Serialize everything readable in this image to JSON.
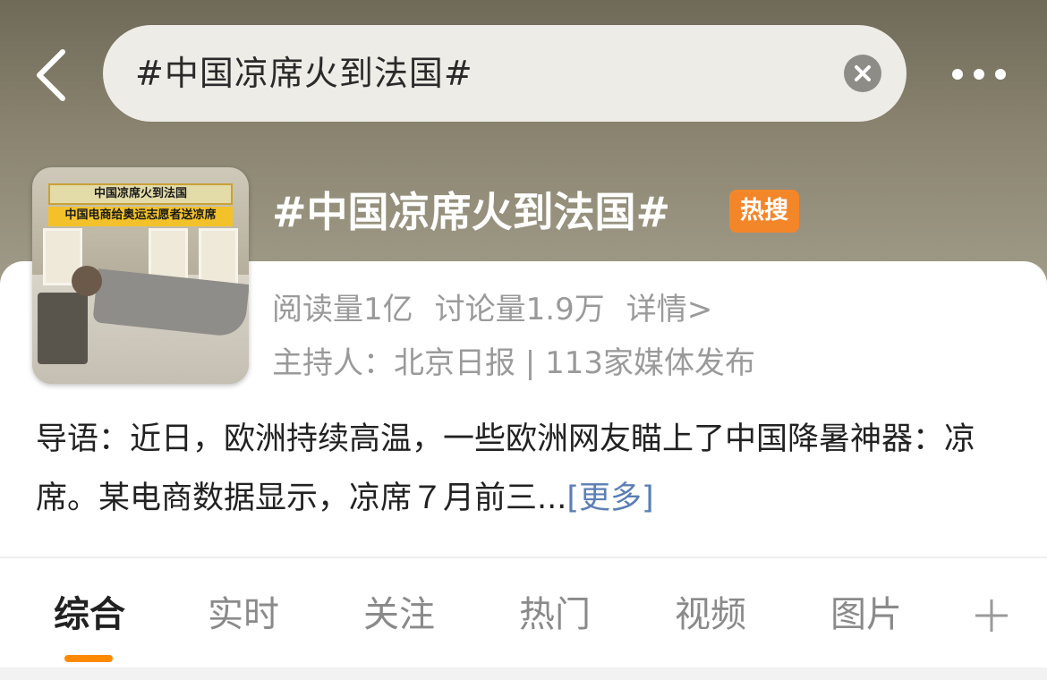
{
  "header": {
    "search_value": "#中国凉席火到法国#",
    "back_icon": "chevron-left-icon",
    "clear_icon": "clear-circle-icon",
    "more_icon": "more-dots-icon"
  },
  "topic": {
    "thumbnail_caption_1": "中国凉席火到法国",
    "thumbnail_caption_2": "中国电商给奥运志愿者送凉席",
    "title": "#中国凉席火到法国#",
    "badge": "热搜",
    "badge_color": "#f4862a",
    "reads": "阅读量1亿",
    "discussions": "讨论量1.9万",
    "details_link": "详情>",
    "host": "主持人：北京日报 | 113家媒体发布"
  },
  "intro": {
    "text": "导语：近日，欧洲持续高温，一些欧洲网友瞄上了中国降暑神器：凉席。某电商数据显示，凉席７月前三...",
    "more_label": "[更多]",
    "more_color": "#5b7fb5"
  },
  "tabs": {
    "items": [
      "综合",
      "实时",
      "关注",
      "热门",
      "视频",
      "图片"
    ],
    "active_index": 0,
    "accent_color": "#ff8a00",
    "add_icon": "plus-icon"
  }
}
